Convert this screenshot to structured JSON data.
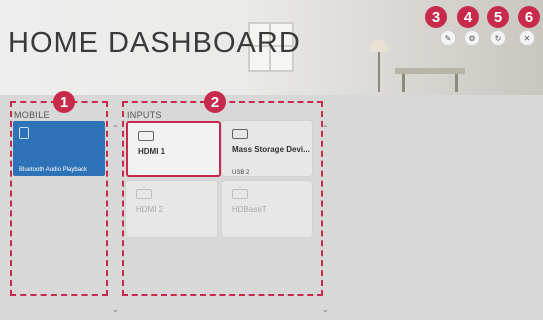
{
  "page": {
    "title": "HOME DASHBOARD"
  },
  "top_icons": [
    {
      "badge": "3",
      "icon": "edit-icon",
      "glyph": "✎"
    },
    {
      "badge": "4",
      "icon": "settings-icon",
      "glyph": "⚙"
    },
    {
      "badge": "5",
      "icon": "refresh-icon",
      "glyph": "↻"
    },
    {
      "badge": "6",
      "icon": "close-icon",
      "glyph": "✕"
    }
  ],
  "sections": {
    "mobile": {
      "badge": "1",
      "label": "MOBILE",
      "items": [
        {
          "name": "Bluetooth Audio Playback",
          "icon": "bluetooth-device-icon"
        }
      ]
    },
    "inputs": {
      "badge": "2",
      "label": "INPUTS",
      "items": [
        {
          "name": "HDMI 1",
          "sub": "",
          "icon": "hdmi-icon",
          "state": "selected"
        },
        {
          "name": "Mass Storage Devi...",
          "sub": "USB 2",
          "icon": "usb-icon",
          "state": "active"
        },
        {
          "name": "HDMI 2",
          "sub": "",
          "icon": "hdmi-icon",
          "state": "disabled"
        },
        {
          "name": "HDBaseT",
          "sub": "",
          "icon": "hdbaset-icon",
          "state": "disabled"
        }
      ]
    }
  },
  "colors": {
    "accent": "#c72a4b",
    "mobile_tile": "#2e73b8"
  }
}
